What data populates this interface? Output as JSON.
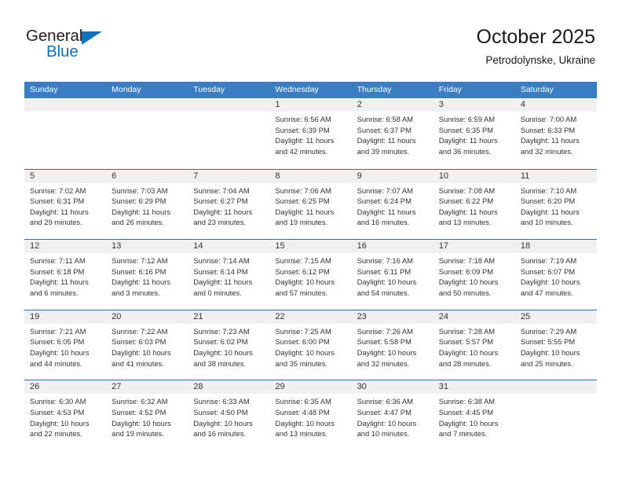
{
  "brand": {
    "name_part1": "General",
    "name_part2": "Blue",
    "accent_color": "#1271bd"
  },
  "header": {
    "title": "October 2025",
    "location": "Petrodolynske, Ukraine"
  },
  "theme": {
    "header_row_color": "#3b7dc4",
    "row_divider_color": "#2a6db5",
    "daynum_band_color": "#f0f0f0",
    "text_color": "#333333"
  },
  "weekdays": [
    "Sunday",
    "Monday",
    "Tuesday",
    "Wednesday",
    "Thursday",
    "Friday",
    "Saturday"
  ],
  "weeks": [
    [
      {
        "day": "",
        "empty": true
      },
      {
        "day": "",
        "empty": true
      },
      {
        "day": "",
        "empty": true
      },
      {
        "day": "1",
        "sunrise": "Sunrise: 6:56 AM",
        "sunset": "Sunset: 6:39 PM",
        "daylight1": "Daylight: 11 hours",
        "daylight2": "and 42 minutes."
      },
      {
        "day": "2",
        "sunrise": "Sunrise: 6:58 AM",
        "sunset": "Sunset: 6:37 PM",
        "daylight1": "Daylight: 11 hours",
        "daylight2": "and 39 minutes."
      },
      {
        "day": "3",
        "sunrise": "Sunrise: 6:59 AM",
        "sunset": "Sunset: 6:35 PM",
        "daylight1": "Daylight: 11 hours",
        "daylight2": "and 36 minutes."
      },
      {
        "day": "4",
        "sunrise": "Sunrise: 7:00 AM",
        "sunset": "Sunset: 6:33 PM",
        "daylight1": "Daylight: 11 hours",
        "daylight2": "and 32 minutes."
      }
    ],
    [
      {
        "day": "5",
        "sunrise": "Sunrise: 7:02 AM",
        "sunset": "Sunset: 6:31 PM",
        "daylight1": "Daylight: 11 hours",
        "daylight2": "and 29 minutes."
      },
      {
        "day": "6",
        "sunrise": "Sunrise: 7:03 AM",
        "sunset": "Sunset: 6:29 PM",
        "daylight1": "Daylight: 11 hours",
        "daylight2": "and 26 minutes."
      },
      {
        "day": "7",
        "sunrise": "Sunrise: 7:04 AM",
        "sunset": "Sunset: 6:27 PM",
        "daylight1": "Daylight: 11 hours",
        "daylight2": "and 23 minutes."
      },
      {
        "day": "8",
        "sunrise": "Sunrise: 7:06 AM",
        "sunset": "Sunset: 6:25 PM",
        "daylight1": "Daylight: 11 hours",
        "daylight2": "and 19 minutes."
      },
      {
        "day": "9",
        "sunrise": "Sunrise: 7:07 AM",
        "sunset": "Sunset: 6:24 PM",
        "daylight1": "Daylight: 11 hours",
        "daylight2": "and 16 minutes."
      },
      {
        "day": "10",
        "sunrise": "Sunrise: 7:08 AM",
        "sunset": "Sunset: 6:22 PM",
        "daylight1": "Daylight: 11 hours",
        "daylight2": "and 13 minutes."
      },
      {
        "day": "11",
        "sunrise": "Sunrise: 7:10 AM",
        "sunset": "Sunset: 6:20 PM",
        "daylight1": "Daylight: 11 hours",
        "daylight2": "and 10 minutes."
      }
    ],
    [
      {
        "day": "12",
        "sunrise": "Sunrise: 7:11 AM",
        "sunset": "Sunset: 6:18 PM",
        "daylight1": "Daylight: 11 hours",
        "daylight2": "and 6 minutes."
      },
      {
        "day": "13",
        "sunrise": "Sunrise: 7:12 AM",
        "sunset": "Sunset: 6:16 PM",
        "daylight1": "Daylight: 11 hours",
        "daylight2": "and 3 minutes."
      },
      {
        "day": "14",
        "sunrise": "Sunrise: 7:14 AM",
        "sunset": "Sunset: 6:14 PM",
        "daylight1": "Daylight: 11 hours",
        "daylight2": "and 0 minutes."
      },
      {
        "day": "15",
        "sunrise": "Sunrise: 7:15 AM",
        "sunset": "Sunset: 6:12 PM",
        "daylight1": "Daylight: 10 hours",
        "daylight2": "and 57 minutes."
      },
      {
        "day": "16",
        "sunrise": "Sunrise: 7:16 AM",
        "sunset": "Sunset: 6:11 PM",
        "daylight1": "Daylight: 10 hours",
        "daylight2": "and 54 minutes."
      },
      {
        "day": "17",
        "sunrise": "Sunrise: 7:18 AM",
        "sunset": "Sunset: 6:09 PM",
        "daylight1": "Daylight: 10 hours",
        "daylight2": "and 50 minutes."
      },
      {
        "day": "18",
        "sunrise": "Sunrise: 7:19 AM",
        "sunset": "Sunset: 6:07 PM",
        "daylight1": "Daylight: 10 hours",
        "daylight2": "and 47 minutes."
      }
    ],
    [
      {
        "day": "19",
        "sunrise": "Sunrise: 7:21 AM",
        "sunset": "Sunset: 6:05 PM",
        "daylight1": "Daylight: 10 hours",
        "daylight2": "and 44 minutes."
      },
      {
        "day": "20",
        "sunrise": "Sunrise: 7:22 AM",
        "sunset": "Sunset: 6:03 PM",
        "daylight1": "Daylight: 10 hours",
        "daylight2": "and 41 minutes."
      },
      {
        "day": "21",
        "sunrise": "Sunrise: 7:23 AM",
        "sunset": "Sunset: 6:02 PM",
        "daylight1": "Daylight: 10 hours",
        "daylight2": "and 38 minutes."
      },
      {
        "day": "22",
        "sunrise": "Sunrise: 7:25 AM",
        "sunset": "Sunset: 6:00 PM",
        "daylight1": "Daylight: 10 hours",
        "daylight2": "and 35 minutes."
      },
      {
        "day": "23",
        "sunrise": "Sunrise: 7:26 AM",
        "sunset": "Sunset: 5:58 PM",
        "daylight1": "Daylight: 10 hours",
        "daylight2": "and 32 minutes."
      },
      {
        "day": "24",
        "sunrise": "Sunrise: 7:28 AM",
        "sunset": "Sunset: 5:57 PM",
        "daylight1": "Daylight: 10 hours",
        "daylight2": "and 28 minutes."
      },
      {
        "day": "25",
        "sunrise": "Sunrise: 7:29 AM",
        "sunset": "Sunset: 5:55 PM",
        "daylight1": "Daylight: 10 hours",
        "daylight2": "and 25 minutes."
      }
    ],
    [
      {
        "day": "26",
        "sunrise": "Sunrise: 6:30 AM",
        "sunset": "Sunset: 4:53 PM",
        "daylight1": "Daylight: 10 hours",
        "daylight2": "and 22 minutes."
      },
      {
        "day": "27",
        "sunrise": "Sunrise: 6:32 AM",
        "sunset": "Sunset: 4:52 PM",
        "daylight1": "Daylight: 10 hours",
        "daylight2": "and 19 minutes."
      },
      {
        "day": "28",
        "sunrise": "Sunrise: 6:33 AM",
        "sunset": "Sunset: 4:50 PM",
        "daylight1": "Daylight: 10 hours",
        "daylight2": "and 16 minutes."
      },
      {
        "day": "29",
        "sunrise": "Sunrise: 6:35 AM",
        "sunset": "Sunset: 4:48 PM",
        "daylight1": "Daylight: 10 hours",
        "daylight2": "and 13 minutes."
      },
      {
        "day": "30",
        "sunrise": "Sunrise: 6:36 AM",
        "sunset": "Sunset: 4:47 PM",
        "daylight1": "Daylight: 10 hours",
        "daylight2": "and 10 minutes."
      },
      {
        "day": "31",
        "sunrise": "Sunrise: 6:38 AM",
        "sunset": "Sunset: 4:45 PM",
        "daylight1": "Daylight: 10 hours",
        "daylight2": "and 7 minutes."
      },
      {
        "day": "",
        "empty": true
      }
    ]
  ]
}
